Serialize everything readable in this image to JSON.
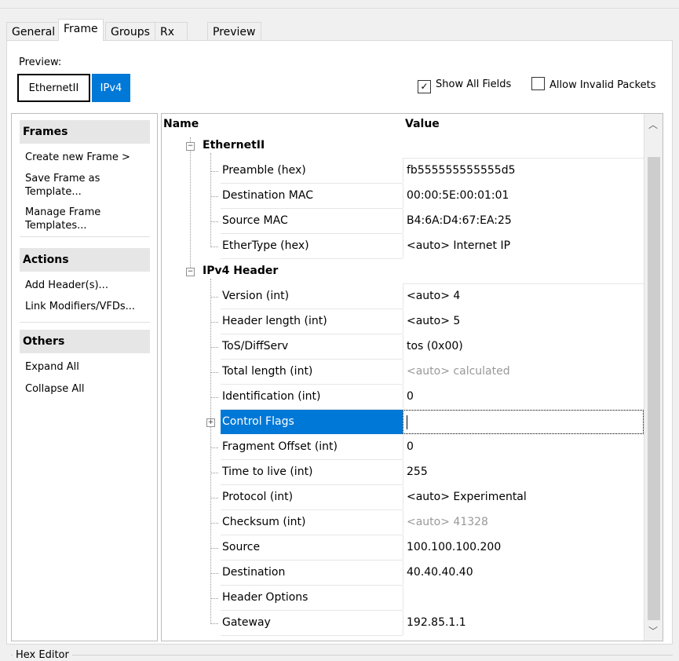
{
  "tabs": [
    "General",
    "Frame",
    "Groups",
    "Rx Port",
    "Preview"
  ],
  "active_tab": "Frame",
  "preview": {
    "label": "Preview:",
    "buttons": [
      "EthernetII",
      "IPv4"
    ],
    "selected": "IPv4"
  },
  "options": {
    "show_all_fields": {
      "label": "Show All Fields",
      "checked": true
    },
    "allow_invalid": {
      "label": "Allow Invalid Packets",
      "checked": false
    }
  },
  "sidebar": {
    "frames_title": "Frames",
    "frames_items": [
      "Create new Frame >",
      "Save Frame as Template...",
      "Manage Frame Templates..."
    ],
    "actions_title": "Actions",
    "actions_items": [
      "Add Header(s)...",
      "Link Modifiers/VFDs..."
    ],
    "others_title": "Others",
    "others_items": [
      "Expand All",
      "Collapse All"
    ]
  },
  "tree": {
    "columns": {
      "name": "Name",
      "value": "Value"
    },
    "groups": [
      {
        "name": "EthernetII",
        "fields": [
          {
            "name": "Preamble (hex)",
            "value": "fb555555555555d5"
          },
          {
            "name": "Destination MAC",
            "value": "00:00:5E:00:01:01"
          },
          {
            "name": "Source MAC",
            "value": "B4:6A:D4:67:EA:25"
          },
          {
            "name": "EtherType (hex)",
            "value": "<auto> Internet IP"
          }
        ]
      },
      {
        "name": "IPv4 Header",
        "fields": [
          {
            "name": "Version (int)",
            "value": "<auto> 4"
          },
          {
            "name": "Header length (int)",
            "value": "<auto> 5"
          },
          {
            "name": "ToS/DiffServ",
            "value": "tos (0x00)"
          },
          {
            "name": "Total length (int)",
            "value": "<auto> calculated",
            "muted": true
          },
          {
            "name": "Identification (int)",
            "value": "0"
          },
          {
            "name": "Control Flags",
            "value": "",
            "selected": true,
            "expandable": true
          },
          {
            "name": "Fragment Offset (int)",
            "value": "0"
          },
          {
            "name": "Time to live (int)",
            "value": "255"
          },
          {
            "name": "Protocol (int)",
            "value": "<auto> Experimental"
          },
          {
            "name": "Checksum (int)",
            "value": "<auto> 41328",
            "muted": true
          },
          {
            "name": "Source",
            "value": "100.100.100.200"
          },
          {
            "name": "Destination",
            "value": "40.40.40.40"
          },
          {
            "name": "Header Options",
            "value": ""
          },
          {
            "name": "Gateway",
            "value": "192.85.1.1"
          }
        ]
      }
    ]
  },
  "hex_editor_label": "Hex Editor"
}
